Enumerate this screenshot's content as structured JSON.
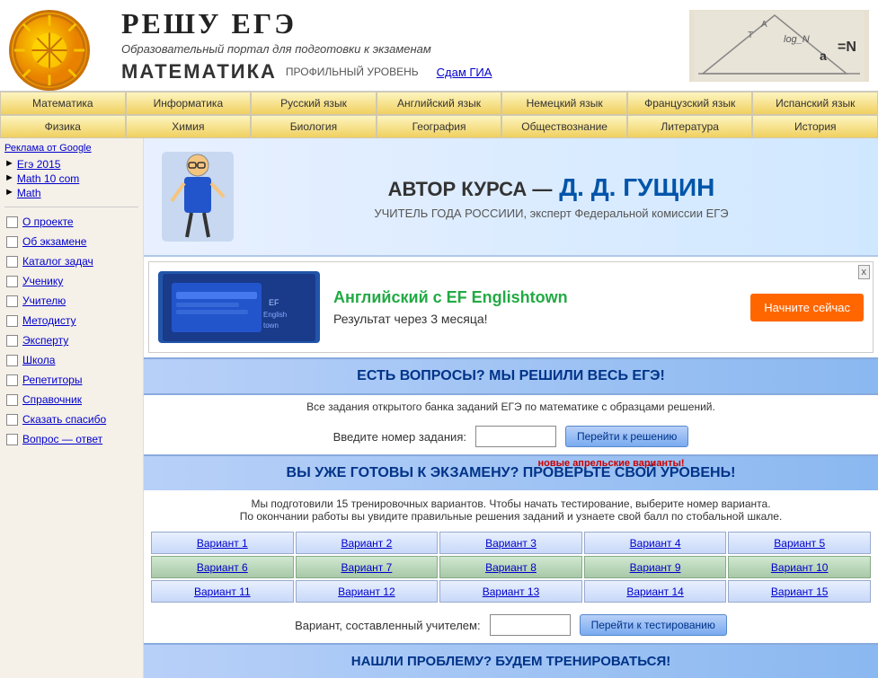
{
  "header": {
    "title": "РЕШУ ЕГЭ",
    "subtitle": "Образовательный портал для подготовки к экзаменам",
    "math_title": "МАТЕМАТИКА",
    "math_level": "ПРОФИЛЬНЫЙ УРОВЕНЬ",
    "gia_link": "Сдам ГИА"
  },
  "nav": {
    "row1": [
      "Математика",
      "Информатика",
      "Русский язык",
      "Английский язык",
      "Немецкий язык",
      "Французский язык",
      "Испанский язык"
    ],
    "row2": [
      "Физика",
      "Химия",
      "Биология",
      "География",
      "Обществознание",
      "Литература",
      "История"
    ]
  },
  "sidebar": {
    "ads_label": "Реклама от Google",
    "ad_items": [
      {
        "label": "Егэ 2015"
      },
      {
        "label": "Math 10 com"
      },
      {
        "label": "Math"
      }
    ],
    "menu_items": [
      {
        "label": "О проекте"
      },
      {
        "label": "Об экзамене"
      },
      {
        "label": "Каталог задач"
      },
      {
        "label": "Ученику"
      },
      {
        "label": "Учителю"
      },
      {
        "label": "Методисту"
      },
      {
        "label": "Эксперту"
      },
      {
        "label": "Школа"
      },
      {
        "label": "Репетиторы"
      },
      {
        "label": "Справочник"
      },
      {
        "label": "Сказать спасибо"
      },
      {
        "label": "Вопрос — ответ"
      }
    ]
  },
  "author_banner": {
    "prefix": "АВТОР КУРСА —",
    "name": "Д. Д. ГУЩИН",
    "subtitle": "УЧИТЕЛЬ ГОДА РОССИИИ, эксперт Федеральной комиссии ЕГЭ"
  },
  "english_ad": {
    "title": "Английский с EF Englishtown",
    "subtitle": "Результат через 3 месяца!",
    "btn_label": "Начните сейчас",
    "close": "x"
  },
  "section1": {
    "header": "ЕСТЬ ВОПРОСЫ? МЫ РЕШИЛИ ВЕСЬ ЕГЭ!",
    "subtext": "Все задания открытого банка заданий ЕГЭ по математике с образцами решений.",
    "input_label": "Введите номер задания:",
    "btn_label": "Перейти к решению",
    "input_placeholder": ""
  },
  "section2": {
    "header": "ВЫ УЖЕ ГОТОВЫ К ЭКЗАМЕНУ? ПРОВЕРЬТЕ СВОЙ УРОВЕНЬ!",
    "new_badge": "новые апрельские варианты!",
    "desc1": "Мы подготовили 15 тренировочных вариантов. Чтобы начать тестирование, выберите номер варианта.",
    "desc2": "По окончании работы вы увидите правильные решения заданий и узнаете свой балл по стобальной шкале.",
    "variants": [
      [
        "Вариант 1",
        "Вариант 2",
        "Вариант 3",
        "Вариант 4",
        "Вариант 5"
      ],
      [
        "Вариант 6",
        "Вариант 7",
        "Вариант 8",
        "Вариант 9",
        "Вариант 10"
      ],
      [
        "Вариант 11",
        "Вариант 12",
        "Вариант 13",
        "Вариант 14",
        "Вариант 15"
      ]
    ],
    "teacher_label": "Вариант, составленный учителем:",
    "teacher_btn": "Перейти к тестированию",
    "teacher_input_placeholder": ""
  },
  "section3": {
    "header": "НАШЛИ ПРОБЛЕМУ? БУДЕМ ТРЕНИРОВАТЬСЯ!"
  }
}
